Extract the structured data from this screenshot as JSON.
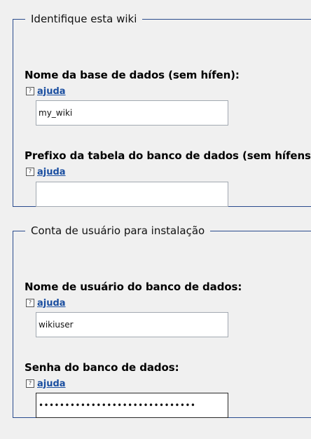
{
  "sections": [
    {
      "legend": "Identifique esta wiki",
      "fields": [
        {
          "label": "Nome da base de dados (sem hífen):",
          "help": "ajuda",
          "value": "my_wiki",
          "type": "text"
        },
        {
          "label": "Prefixo da tabela do banco de dados (sem hífens)::",
          "help": "ajuda",
          "value": "",
          "type": "text"
        }
      ]
    },
    {
      "legend": "Conta de usuário para instalação",
      "fields": [
        {
          "label": "Nome de usuário do banco de dados:",
          "help": "ajuda",
          "value": "wikiuser",
          "type": "text"
        },
        {
          "label": "Senha do banco de dados:",
          "help": "ajuda",
          "value": "••••••••••••••••••••••••••••••",
          "type": "password"
        }
      ]
    }
  ],
  "icons": {
    "help": "help-icon"
  },
  "colors": {
    "border": "#2a4b8d",
    "link": "#1a4ea0",
    "background": "#f0f0f0"
  }
}
